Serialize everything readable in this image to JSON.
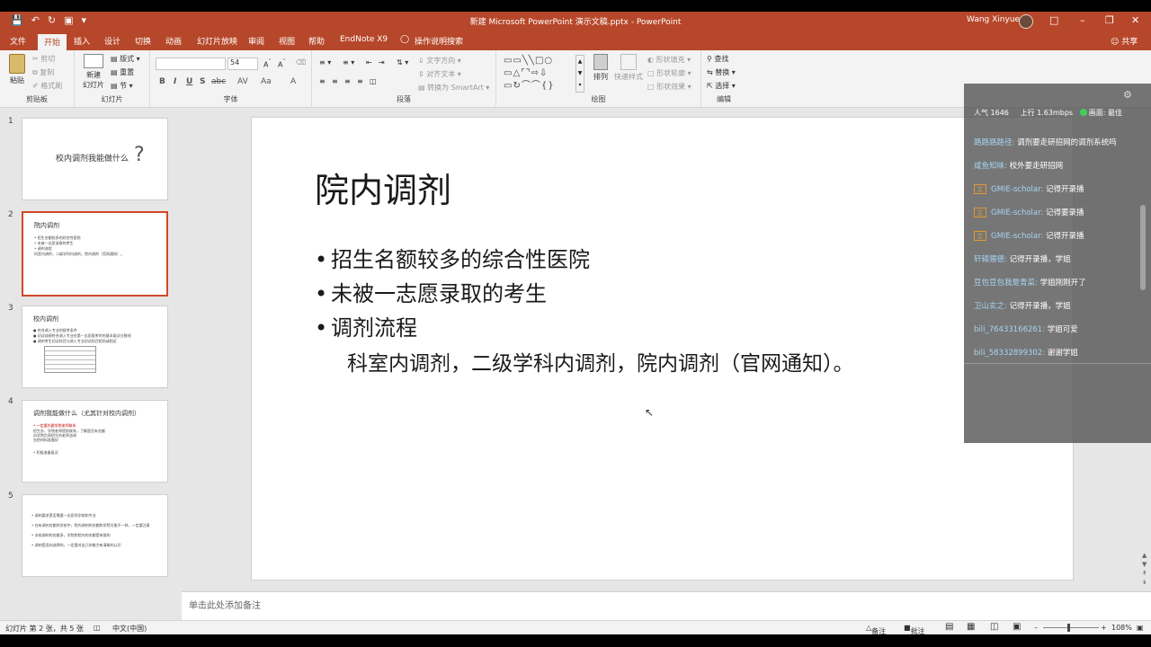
{
  "window": {
    "title": "新建 Microsoft PowerPoint 演示文稿.pptx  -  PowerPoint",
    "user": "Wang Xinyue",
    "share": "共享"
  },
  "tabs": [
    "文件",
    "开始",
    "插入",
    "设计",
    "切换",
    "动画",
    "幻灯片放映",
    "审阅",
    "视图",
    "帮助",
    "EndNote X9",
    "操作说明搜索"
  ],
  "ribbon": {
    "clipboard": {
      "paste": "粘贴",
      "cut": "剪切",
      "copy": "复制",
      "format_painter": "格式刷",
      "label": "剪贴板"
    },
    "slides": {
      "new_slide": "新建",
      "new_slide2": "幻灯片",
      "layout": "版式",
      "reset": "重置",
      "section": "节",
      "label": "幻灯片"
    },
    "font": {
      "size": "54",
      "label": "字体",
      "bold": "B",
      "italic": "I",
      "underline": "U",
      "strike": "S",
      "shadow": "abc",
      "spacing": "AV",
      "case": "Aa"
    },
    "paragraph": {
      "text_direction": "文字方向",
      "align_text": "对齐文本",
      "smartart": "转换为 SmartArt",
      "label": "段落"
    },
    "drawing": {
      "arrange": "排列",
      "quick_styles": "快速样式",
      "shape_fill": "形状填充",
      "shape_outline": "形状轮廓",
      "shape_effects": "形状效果",
      "label": "绘图"
    },
    "editing": {
      "find": "查找",
      "replace": "替换",
      "select": "选择",
      "label": "编辑"
    }
  },
  "thumbnails": [
    {
      "num": "1",
      "title": "校内调剂我能做什么"
    },
    {
      "num": "2",
      "title": "院内调剂",
      "lines": [
        "• 招生名额较多的综合性医院",
        "• 未被一志愿录取的考生",
        "• 调剂流程",
        "    科室内调剂，二级学科内调剂，院内调剂（官网通知）。"
      ]
    },
    {
      "num": "3",
      "title": "校内调剂",
      "lines": [
        "● 符合调入专业的报考条件",
        "● 初试成绩符合调入专业在第一志愿报考时的基本复试分数线",
        "● 调剂考生初试科目与调入专业初试科目相同或相近"
      ]
    },
    {
      "num": "4",
      "title": "调剂我能做什么（尤其针对校内调剂）",
      "lines": [
        "• 一定要先跟学院老师联系",
        "  招生办、学院老师提前联系，了解是否有名额",
        "  向学院负责招生的老师咨询",
        "  先把材料准备好",
        "• 积极准备复试"
      ]
    },
    {
      "num": "5",
      "lines": [
        "• 调剂要求是否需要一志愿的学校和专业",
        "• 在有调剂名额的学校中，院内调剂的名额和学院可能不一样，一定要注意",
        "• 本校调剂的名额多，学院和院内的名额是有限的",
        "• 调剂是双向选择的，一定要对自己的能力有清晰的认识"
      ]
    }
  ],
  "slide": {
    "title": "院内调剂",
    "bullets": [
      "招生名额较多的综合性医院",
      "未被一志愿录取的考生",
      "调剂流程"
    ],
    "bullet_char": "•",
    "sub": "科室内调剂，二级学科内调剂，院内调剂（官网通知）。"
  },
  "notes_placeholder": "单击此处添加备注",
  "status": {
    "slide_info": "幻灯片 第 2 张，共 5 张",
    "language": "中文(中国)",
    "notes": "备注",
    "comments": "批注",
    "zoom": "108%"
  },
  "overlay": {
    "popularity": "人气  1646",
    "upload": "上行  1.63mbps",
    "quality": "画面: 最佳",
    "messages": [
      {
        "name": "路路路路径:",
        "msg": "调剂要走研招网的调剂系统吗",
        "badge": false
      },
      {
        "name": "咸鱼知味:",
        "msg": "校外要走研招网",
        "badge": false
      },
      {
        "name": "GMIE-scholar:",
        "msg": "记得开录播",
        "badge": true
      },
      {
        "name": "GMIE-scholar:",
        "msg": "记得要录播",
        "badge": true
      },
      {
        "name": "GMIE-scholar:",
        "msg": "记得开录播",
        "badge": true
      },
      {
        "name": "轩辕猥德:",
        "msg": "记得开录播，学姐",
        "badge": false
      },
      {
        "name": "豆包豆包我是青菜:",
        "msg": "学姐刚刚开了",
        "badge": false
      },
      {
        "name": "卫山玄之:",
        "msg": "记得开录播，学姐",
        "badge": false
      },
      {
        "name": "bili_76433166261:",
        "msg": "学姐可爱",
        "badge": false
      },
      {
        "name": "bili_58332899302:",
        "msg": "谢谢学姐",
        "badge": false
      }
    ],
    "badge_char": "主"
  },
  "colors": {
    "accent": "#b7472a",
    "selected_thumb": "#d24726"
  }
}
